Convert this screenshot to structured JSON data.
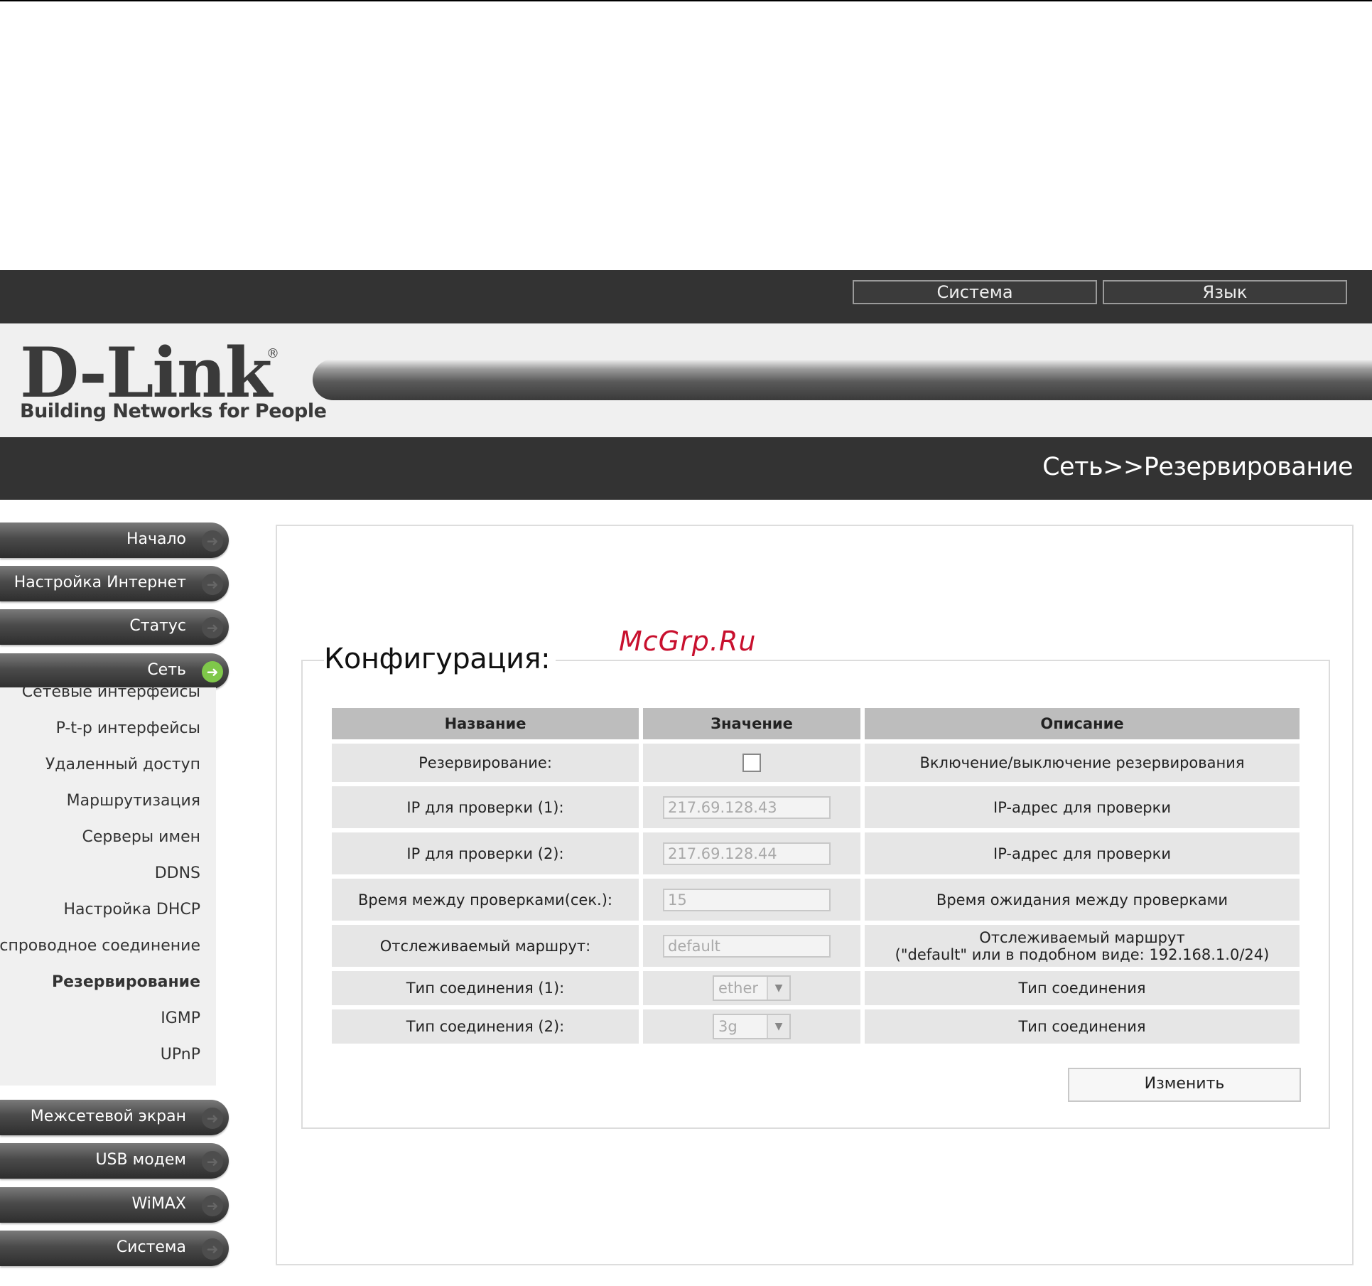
{
  "topbar": {
    "system_label": "Система",
    "language_label": "Язык"
  },
  "logo": {
    "brand": "D-Link",
    "registered": "®",
    "tagline": "Building Networks for People"
  },
  "breadcrumb": {
    "text": "Сеть>>Резервирование"
  },
  "sidebar": {
    "top_items": [
      {
        "label": "Начало"
      },
      {
        "label": "Настройка Интернет"
      },
      {
        "label": "Статус"
      },
      {
        "label": "Сеть"
      }
    ],
    "sub_items": [
      {
        "label": "Сетевые интерфейсы"
      },
      {
        "label": "P-t-p интерфейсы"
      },
      {
        "label": "Удаленный доступ"
      },
      {
        "label": "Маршрутизация"
      },
      {
        "label": "Серверы имен"
      },
      {
        "label": "DDNS"
      },
      {
        "label": "Настройка DHCP"
      },
      {
        "label": "Беспроводное соединение"
      },
      {
        "label": "Резервирование"
      },
      {
        "label": "IGMP"
      },
      {
        "label": "UPnP"
      }
    ],
    "bottom_items": [
      {
        "label": "Межсетевой экран"
      },
      {
        "label": "USB модем"
      },
      {
        "label": "WiMAX"
      },
      {
        "label": "Система"
      }
    ]
  },
  "config": {
    "legend": "Конфигурация:",
    "headers": {
      "name": "Название",
      "value": "Значение",
      "description": "Описание"
    },
    "rows": {
      "backup": {
        "name": "Резервирование:",
        "desc": "Включение/выключение резервирования"
      },
      "ip1": {
        "name": "IP для проверки (1):",
        "value": "217.69.128.43",
        "desc": "IP-адрес для проверки"
      },
      "ip2": {
        "name": "IP для проверки (2):",
        "value": "217.69.128.44",
        "desc": "IP-адрес для проверки"
      },
      "interval": {
        "name": "Время между проверками(сек.):",
        "value": "15",
        "desc": "Время ожидания между проверками"
      },
      "route": {
        "name": "Отслеживаемый маршрут:",
        "value": "default",
        "desc_line1": "Отслеживаемый маршрут",
        "desc_line2": "(\"default\" или в подобном виде: 192.168.1.0/24)"
      },
      "conn1": {
        "name": "Тип соединения (1):",
        "value": "ether",
        "desc": "Тип соединения"
      },
      "conn2": {
        "name": "Тип соединения (2):",
        "value": "3g",
        "desc": "Тип соединения"
      }
    },
    "change_button": "Изменить"
  },
  "watermark": "McGrp.Ru"
}
